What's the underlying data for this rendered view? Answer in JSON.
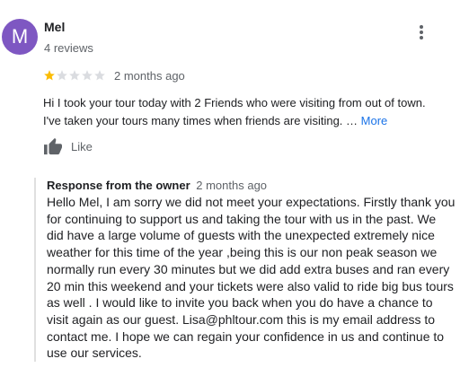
{
  "reviewer": {
    "avatar_letter": "M",
    "avatar_color": "#7e57c2",
    "name": "Mel",
    "reviews": "4 reviews"
  },
  "review": {
    "rating": 1,
    "max_rating": 5,
    "star_filled_color": "#fbbc04",
    "star_empty_color": "#dadce0",
    "date": "2 months ago",
    "text_line1": "Hi I took your tour today with 2 Friends who were visiting from out of town.",
    "text_line2": "I've taken your tours many times when friends are visiting. … ",
    "more_label": "More",
    "like_label": "Like",
    "menu_icon": "more-vertical-icon"
  },
  "owner_response": {
    "title": "Response from the owner",
    "date": "2 months ago",
    "text": "Hello Mel, I am sorry we did not meet your expectations. Firstly thank you for continuing to support us and taking the tour with us in the past. We did have a large volume of guests with the unexpected extremely nice weather for this time of the year ,being this is our non peak season we normally run every 30 minutes but we did add extra buses and ran every 20 min this weekend and your tickets were also valid to ride big bus tours as well . I would like to invite you back when you do have a chance to visit again as our guest. Lisa@phltour.com this is my email address to contact me. I hope we can regain your confidence in us and continue to use our services."
  }
}
